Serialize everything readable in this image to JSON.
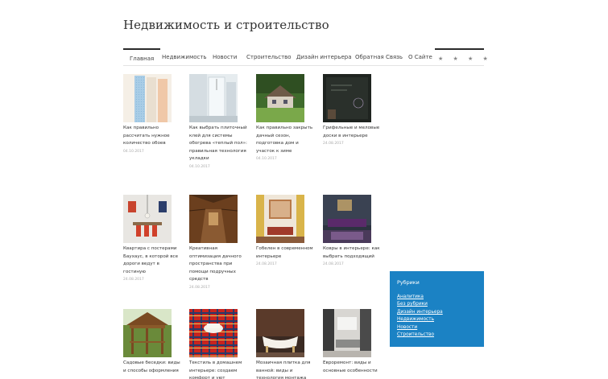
{
  "site": {
    "title": "Недвижимость и строительство"
  },
  "nav": {
    "items": [
      "Главная",
      "Недвижимость",
      "Новости",
      "Строительство",
      "Дизайн интерьера",
      "Обратная Связь",
      "О Сайте"
    ],
    "stars": "★ ★ ★ ★"
  },
  "posts": [
    {
      "title": "Как правильно рассчитать нужное количество обоев",
      "date": "04.10.2017",
      "image": "wallpaper-rolls"
    },
    {
      "title": "Как выбрать плиточный клей для системы обогрева «теплый пол»: правильная технология укладки",
      "date": "04.10.2017",
      "image": "bathroom-shower"
    },
    {
      "title": "Как правильно закрыть дачный сезон, подготовка дом и участок к зиме",
      "date": "04.10.2017",
      "image": "country-house"
    },
    {
      "title": "Грифельные и меловые доски в интерьере",
      "date": "24.08.2017",
      "image": "chalkboard"
    },
    {
      "title": "Квартира с постерами Баухаус, в которой все дороги ведут в гостиную",
      "date": "24.08.2017",
      "image": "bauhaus-dining"
    },
    {
      "title": "Креативная оптимизация дачного пространства при помощи подручных средств",
      "date": "24.08.2017",
      "image": "wooden-attic"
    },
    {
      "title": "Гобелен в современном интерьере",
      "date": "24.08.2017",
      "image": "tapestry-room"
    },
    {
      "title": "Ковры в интерьере: как выбрать подходящий",
      "date": "24.08.2017",
      "image": "carpet-room"
    },
    {
      "title": "Садовые беседки: виды и способы оформления",
      "date": "",
      "image": "gazebo"
    },
    {
      "title": "Текстиль в домашнем интерьере: создаем комфорт и уют",
      "date": "",
      "image": "tartan-textile"
    },
    {
      "title": "Мозаичная плитка для ванной: виды и технология монтажа",
      "date": "",
      "image": "mosaic-bathtub"
    },
    {
      "title": "Евроремонт: виды и основные особенности",
      "date": "",
      "image": "living-room"
    }
  ],
  "sidebar": {
    "title": "Рубрики",
    "categories": [
      "Аналитика",
      "Без рубрики",
      "Дизайн интерьера",
      "Недвижимость",
      "Новости",
      "Строительство"
    ]
  },
  "colors": {
    "widget_bg": "#1b82c4",
    "text": "#333333",
    "date": "#aaaaaa"
  }
}
